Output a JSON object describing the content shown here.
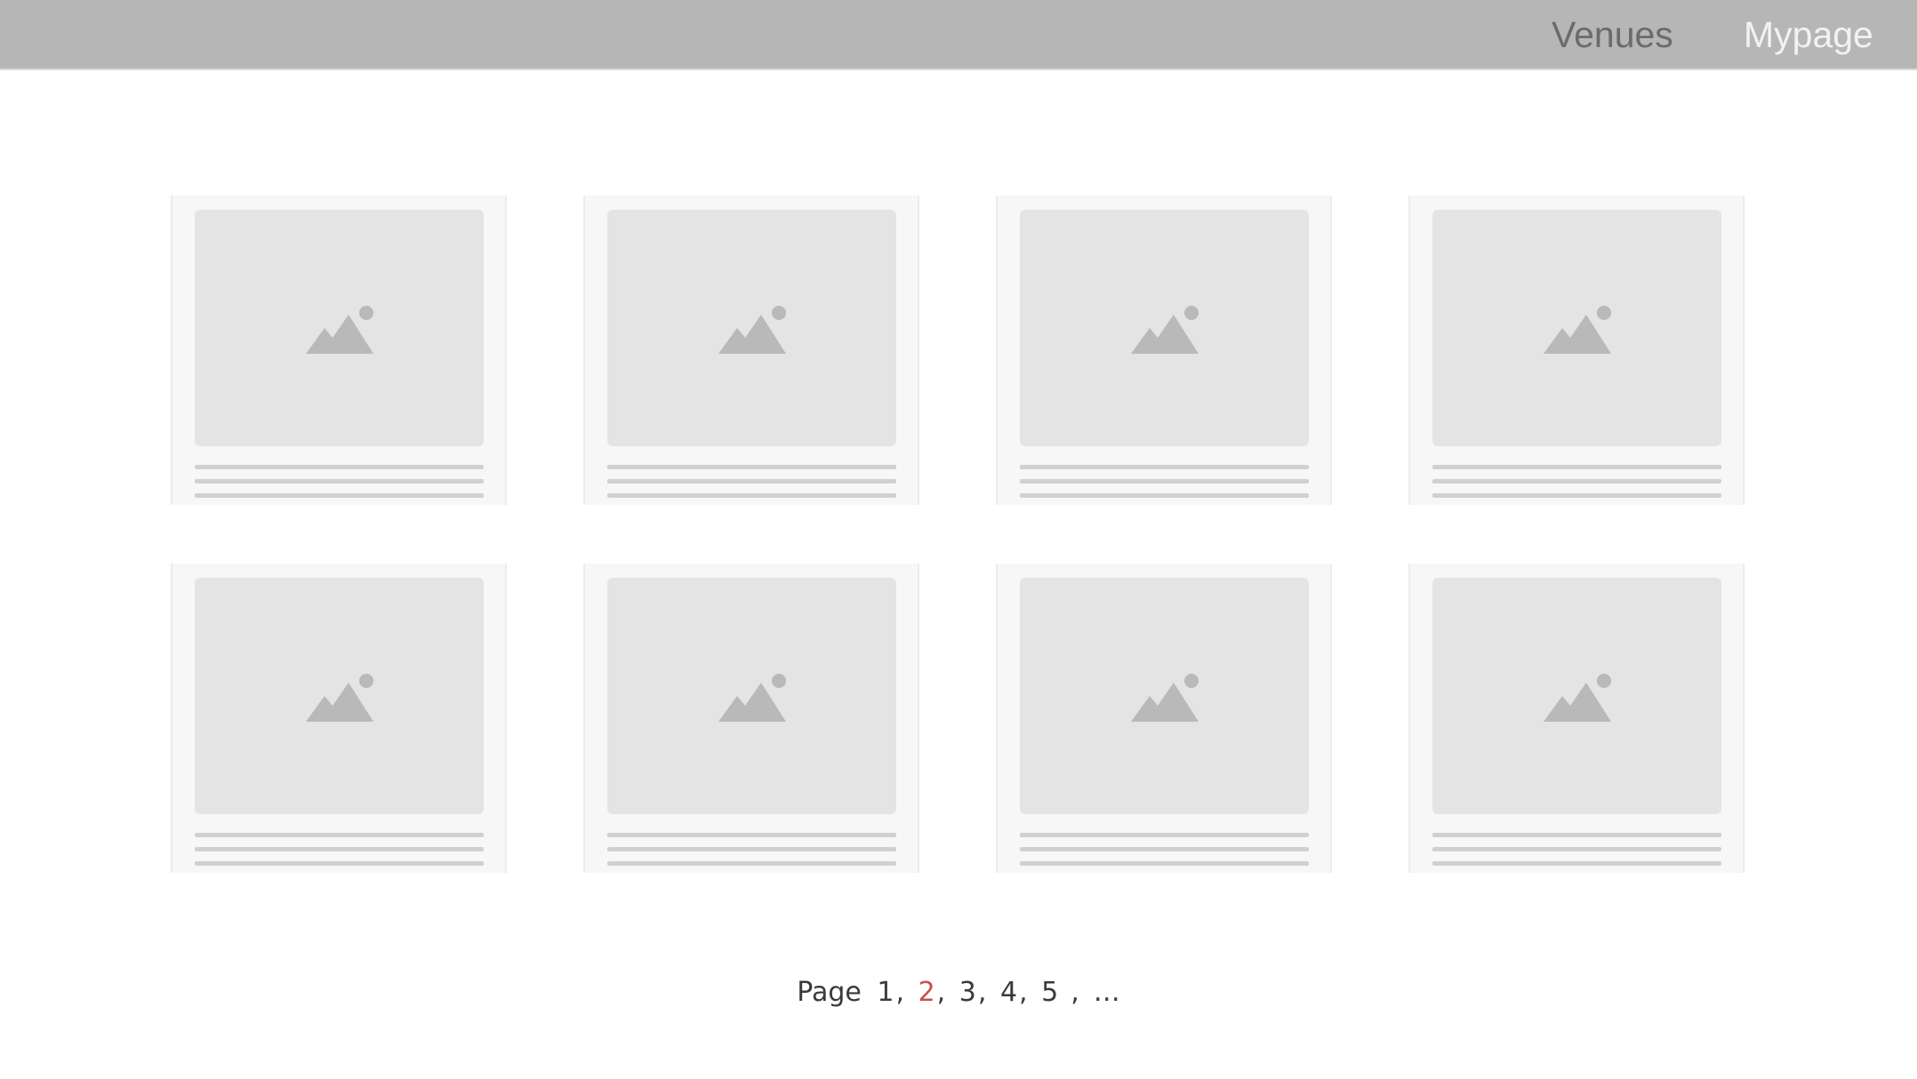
{
  "nav": {
    "venues": "Venues",
    "mypage": "Mypage"
  },
  "cards": [
    {
      "icon": "image-placeholder-icon"
    },
    {
      "icon": "image-placeholder-icon"
    },
    {
      "icon": "image-placeholder-icon"
    },
    {
      "icon": "image-placeholder-icon"
    },
    {
      "icon": "image-placeholder-icon"
    },
    {
      "icon": "image-placeholder-icon"
    },
    {
      "icon": "image-placeholder-icon"
    },
    {
      "icon": "image-placeholder-icon"
    }
  ],
  "pagination": {
    "label": "Page",
    "pages": [
      "1",
      "2",
      "3",
      "4",
      "5"
    ],
    "current": "2",
    "ellipsis": "…",
    "separator": ","
  },
  "colors": {
    "header_bg": "#b6b6b6",
    "current_page": "#c6504b"
  }
}
